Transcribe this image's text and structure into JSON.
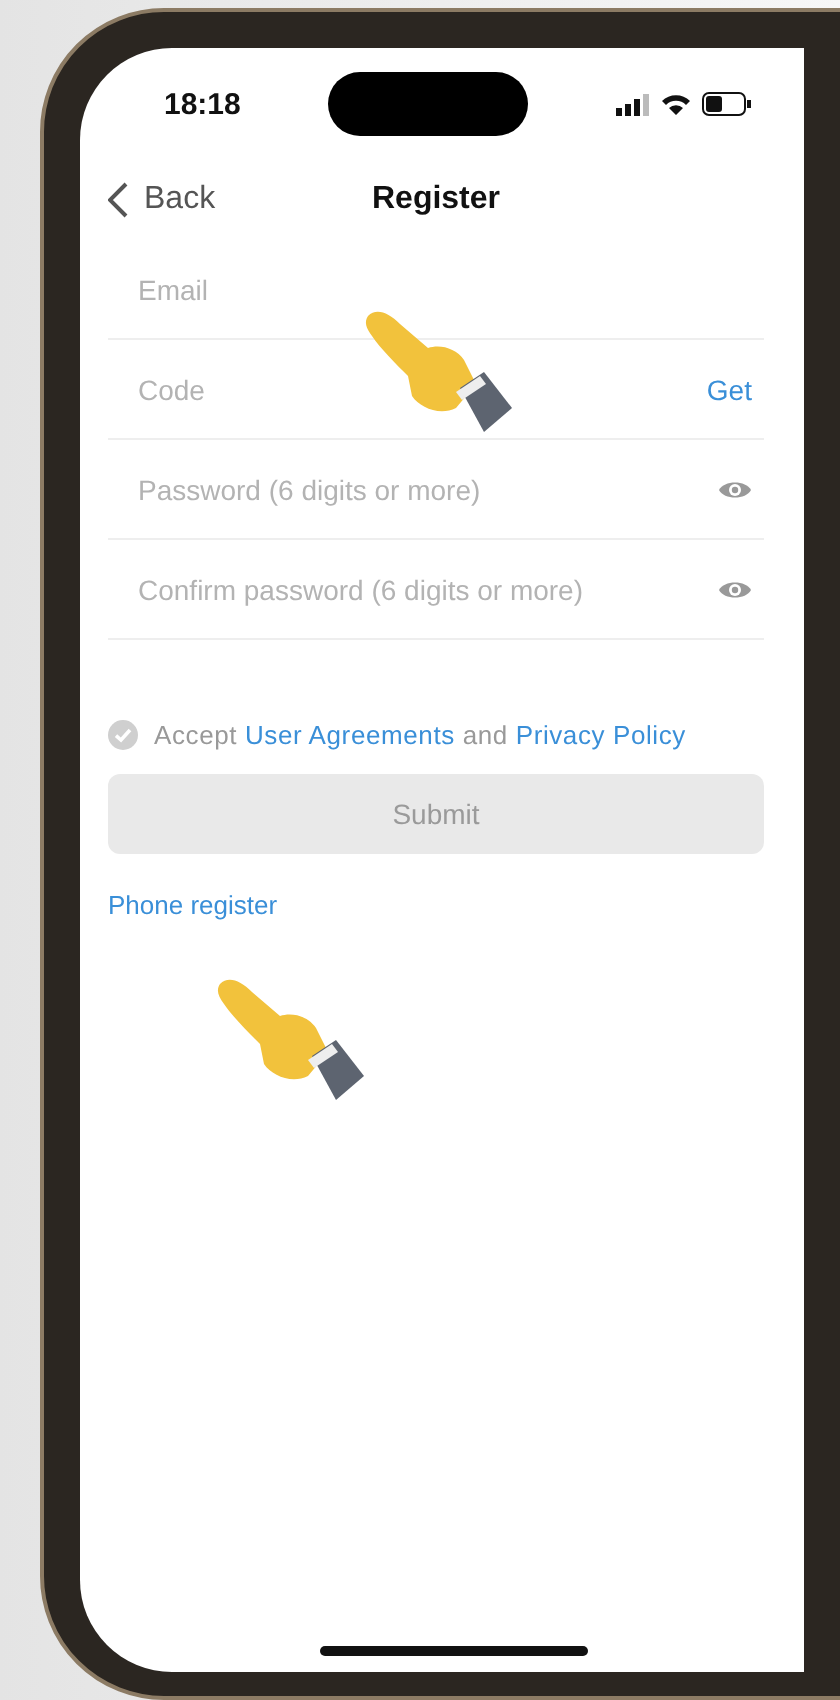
{
  "status_bar": {
    "time": "18:18"
  },
  "nav": {
    "back": "Back",
    "title": "Register"
  },
  "fields": [
    {
      "kind": "plain",
      "placeholder": "Email"
    },
    {
      "kind": "code",
      "placeholder": "Code",
      "action": "Get"
    },
    {
      "kind": "password",
      "placeholder": "Password (6 digits or more)"
    },
    {
      "kind": "password",
      "placeholder": "Confirm password (6 digits or more)"
    }
  ],
  "agreement": {
    "checked": false,
    "prefix": "Accept",
    "link_1": "User Agreements",
    "middle": "and",
    "link_2": "Privacy Policy"
  },
  "submit": {
    "label": "Submit",
    "disabled": true
  },
  "alt_link": "Phone register"
}
